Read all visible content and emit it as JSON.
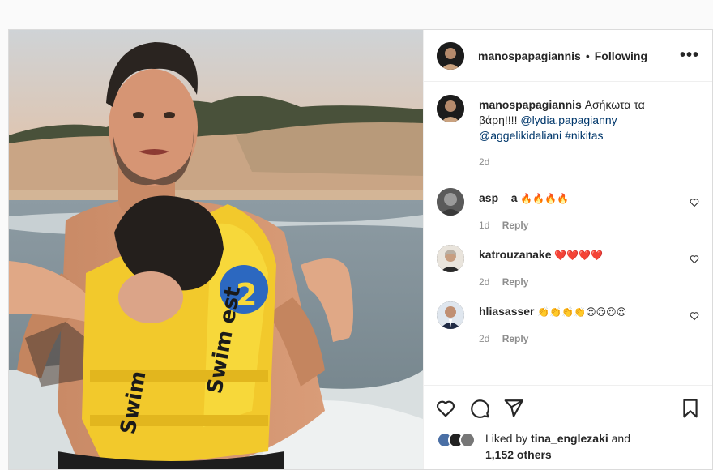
{
  "post": {
    "author": "manospapagiannis",
    "separator": "•",
    "follow_status": "Following",
    "more_label": "•••",
    "caption": {
      "username": "manospapagiannis",
      "text": "Ασήκωτα τα βάρη!!!!",
      "mention1": "@lydia.papagianny",
      "mention2": "@aggelikidaliani",
      "hashtag": "#nikitas",
      "time": "2d"
    },
    "comments": [
      {
        "username": "asp__a",
        "text": "🔥🔥🔥🔥",
        "time": "1d",
        "reply": "Reply"
      },
      {
        "username": "katrouzanake",
        "text": "❤️❤️❤️❤️",
        "time": "2d",
        "reply": "Reply"
      },
      {
        "username": "hliasasser",
        "text": "👏👏👏👏😍😍😍😍",
        "time": "2d",
        "reply": "Reply"
      }
    ],
    "likes": {
      "prefix": "Liked by",
      "liker": "tina_englezaki",
      "and": "and",
      "others": "1,152 others"
    },
    "icons": {
      "like": "heart-icon",
      "comment": "comment-icon",
      "share": "share-icon",
      "save": "bookmark-icon"
    },
    "colors": {
      "mention": "#00376b",
      "meta": "#8e8e8e",
      "border": "#dbdbdb"
    }
  }
}
